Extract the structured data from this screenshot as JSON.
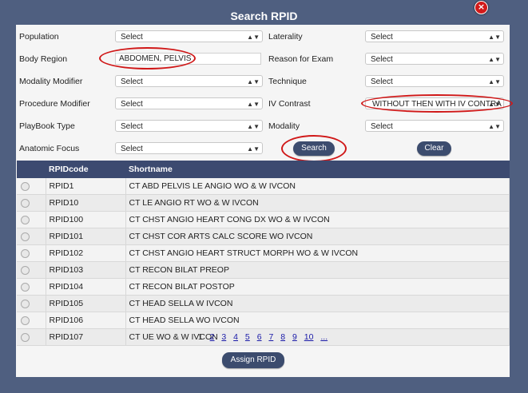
{
  "dialog": {
    "title": "Search RPID",
    "close_glyph": "×"
  },
  "form": {
    "population": {
      "label": "Population",
      "value": "Select"
    },
    "laterality": {
      "label": "Laterality",
      "value": "Select"
    },
    "body_region": {
      "label": "Body Region",
      "value": "ABDOMEN, PELVIS"
    },
    "reason_for_exam": {
      "label": "Reason for Exam",
      "value": "Select"
    },
    "modality_modifier": {
      "label": "Modality Modifier",
      "value": "Select"
    },
    "technique": {
      "label": "Technique",
      "value": "Select"
    },
    "procedure_modifier": {
      "label": "Procedure Modifier",
      "value": "Select"
    },
    "iv_contrast": {
      "label": "IV Contrast",
      "value": "WITHOUT THEN WITH IV CONTRA"
    },
    "playbook_type": {
      "label": "PlayBook Type",
      "value": "Select"
    },
    "modality": {
      "label": "Modality",
      "value": "Select"
    },
    "anatomic_focus": {
      "label": "Anatomic Focus",
      "value": "Select"
    },
    "search_label": "Search",
    "clear_label": "Clear"
  },
  "table": {
    "headers": [
      "",
      "RPIDcode",
      "Shortname"
    ],
    "rows": [
      {
        "code": "RPID1",
        "name": "CT ABD PELVIS LE ANGIO WO & W IVCON"
      },
      {
        "code": "RPID10",
        "name": "CT LE ANGIO RT WO & W IVCON"
      },
      {
        "code": "RPID100",
        "name": "CT CHST ANGIO HEART CONG DX WO & W IVCON"
      },
      {
        "code": "RPID101",
        "name": "CT CHST COR ARTS CALC SCORE WO IVCON"
      },
      {
        "code": "RPID102",
        "name": "CT CHST ANGIO HEART STRUCT MORPH WO & W IVCON"
      },
      {
        "code": "RPID103",
        "name": "CT RECON BILAT PREOP"
      },
      {
        "code": "RPID104",
        "name": "CT RECON BILAT POSTOP"
      },
      {
        "code": "RPID105",
        "name": "CT HEAD SELLA W IVCON"
      },
      {
        "code": "RPID106",
        "name": "CT HEAD SELLA WO IVCON"
      },
      {
        "code": "RPID107",
        "name": "CT UE WO & W IVCON"
      }
    ]
  },
  "pager": {
    "current": "1",
    "pages": [
      "2",
      "3",
      "4",
      "5",
      "6",
      "7",
      "8",
      "9",
      "10",
      "..."
    ]
  },
  "assign_label": "Assign RPID",
  "colors": {
    "accent": "#3c4c6e",
    "highlight_ring": "#d01818",
    "backdrop": "#4f5f80"
  }
}
